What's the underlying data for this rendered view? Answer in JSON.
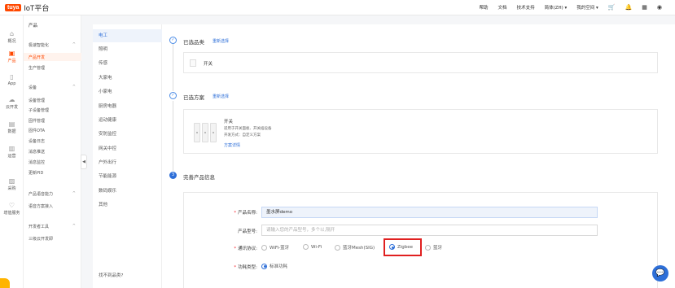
{
  "topbar": {
    "logo_brand": "tuya",
    "logo_text": "IoT平台",
    "links": [
      "帮助",
      "文档",
      "技术支持",
      "简体(ZH)",
      "我的空间"
    ],
    "icons": [
      "cart-icon",
      "bell-icon",
      "apps-grid-icon",
      "user-icon"
    ]
  },
  "sidebar": {
    "items": [
      {
        "label": "概况",
        "icon": "home-icon"
      },
      {
        "label": "产品",
        "icon": "product-icon",
        "active": true
      },
      {
        "label": "App",
        "icon": "phone-icon"
      },
      {
        "label": "云开发",
        "icon": "cloud-icon"
      },
      {
        "label": "数据",
        "icon": "chart-icon"
      },
      {
        "label": "运营",
        "icon": "operation-icon"
      },
      {
        "label": "采购",
        "icon": "purchase-icon"
      },
      {
        "label": "增值服务",
        "icon": "value-add-icon"
      }
    ]
  },
  "submenu": {
    "header": "产品",
    "groups": [
      {
        "title": "极速智能化",
        "items": [
          "产品开发",
          "生产管理"
        ]
      },
      {
        "title": "设备",
        "items": [
          "设备管理",
          "子设备管理",
          "固件管理",
          "固件OTA",
          "设备日志",
          "消息推送",
          "消息监控",
          "更新PID"
        ]
      },
      {
        "title": "产品语音能力",
        "items": [
          "语音方案接入"
        ]
      },
      {
        "title": "开发者工具",
        "items": [
          "三级云开发即"
        ]
      }
    ]
  },
  "categories": {
    "items": [
      "电工",
      "照明",
      "传感",
      "大家电",
      "小家电",
      "厨房电器",
      "运动健康",
      "安防监控",
      "网关中控",
      "户外出行",
      "节能能源",
      "数码娱乐",
      "其他"
    ],
    "active_index": 0,
    "footer": "找不到品类?"
  },
  "steps": {
    "step1": {
      "title": "已选品类",
      "link": "重新选择",
      "selected": "开关"
    },
    "step2": {
      "title": "已选方案",
      "link": "重新选择",
      "plan_name": "开关",
      "plan_desc_1": "适用于开关面板、开关插设备",
      "plan_desc_2": "开发方式：自定义方案",
      "plan_link": "方案详情"
    },
    "step3": {
      "number": "3",
      "title": "完善产品信息"
    }
  },
  "form": {
    "name_label": "产品名称:",
    "name_value": "墨水屏demo",
    "model_label": "产品型号:",
    "model_placeholder": "请输入您的产品型号，多个以,隔开",
    "protocol_label": "通讯协议:",
    "protocol_options": [
      "WiFi-蓝牙",
      "Wi-Fi",
      "蓝牙Mesh(SIG)",
      "Zigbee",
      "蓝牙"
    ],
    "protocol_selected": "Zigbee",
    "power_label": "功耗类型:",
    "power_value": "标准功耗"
  }
}
